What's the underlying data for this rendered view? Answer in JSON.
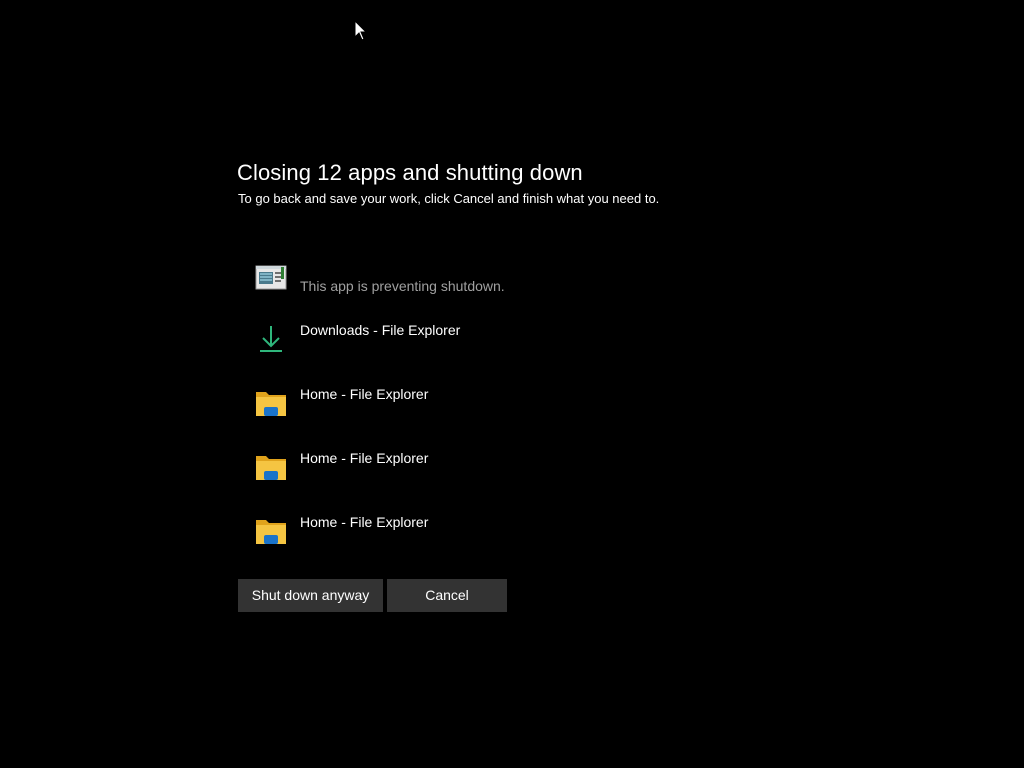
{
  "dialog": {
    "title": "Closing 12 apps and shutting down",
    "subtitle": "To go back and save your work, click Cancel and finish what you need to."
  },
  "apps": [
    {
      "name": "",
      "note": "This app is preventing shutdown.",
      "icon": "app-window-icon"
    },
    {
      "name": "Downloads - File Explorer",
      "icon": "download-icon"
    },
    {
      "name": "Home - File Explorer",
      "icon": "folder-icon"
    },
    {
      "name": "Home - File Explorer",
      "icon": "folder-icon"
    },
    {
      "name": "Home - File Explorer",
      "icon": "folder-icon"
    }
  ],
  "buttons": {
    "shutdown_label": "Shut down anyway",
    "cancel_label": "Cancel"
  },
  "colors": {
    "background": "#000000",
    "button": "#333333",
    "note_text": "#a0a0a0",
    "download_green": "#2fb67c",
    "folder_yellow": "#f5c542",
    "folder_blue": "#1a73c9"
  }
}
